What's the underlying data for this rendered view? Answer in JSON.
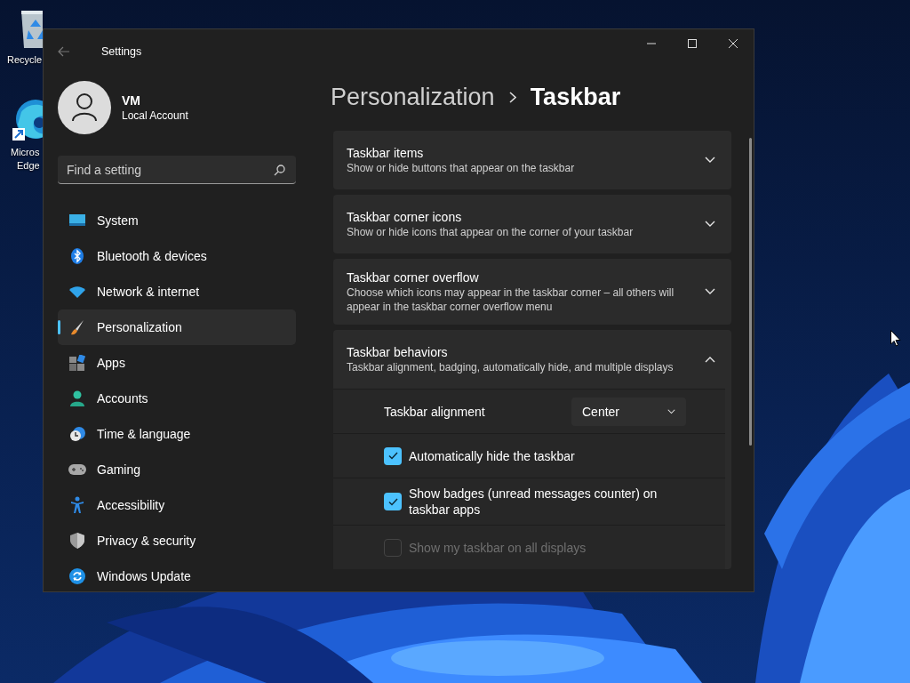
{
  "desktop": {
    "icons": [
      {
        "lines": [
          "Recycle"
        ]
      },
      {
        "lines": [
          "Micros",
          "Edge"
        ]
      }
    ]
  },
  "window": {
    "title": "Settings",
    "user": {
      "name": "VM",
      "account": "Local Account"
    },
    "search": {
      "placeholder": "Find a setting"
    },
    "nav": [
      {
        "label": "System",
        "selected": false
      },
      {
        "label": "Bluetooth & devices",
        "selected": false
      },
      {
        "label": "Network & internet",
        "selected": false
      },
      {
        "label": "Personalization",
        "selected": true
      },
      {
        "label": "Apps",
        "selected": false
      },
      {
        "label": "Accounts",
        "selected": false
      },
      {
        "label": "Time & language",
        "selected": false
      },
      {
        "label": "Gaming",
        "selected": false
      },
      {
        "label": "Accessibility",
        "selected": false
      },
      {
        "label": "Privacy & security",
        "selected": false
      },
      {
        "label": "Windows Update",
        "selected": false
      }
    ],
    "breadcrumb": {
      "parent": "Personalization",
      "current": "Taskbar"
    },
    "sections": [
      {
        "title": "Taskbar items",
        "description": "Show or hide buttons that appear on the taskbar",
        "expanded": false
      },
      {
        "title": "Taskbar corner icons",
        "description": "Show or hide icons that appear on the corner of your taskbar",
        "expanded": false
      },
      {
        "title": "Taskbar corner overflow",
        "description": "Choose which icons may appear in the taskbar corner – all others will appear in the taskbar corner overflow menu",
        "expanded": false
      },
      {
        "title": "Taskbar behaviors",
        "description": "Taskbar alignment, badging, automatically hide, and multiple displays",
        "expanded": true,
        "settings": [
          {
            "kind": "dropdown",
            "label": "Taskbar alignment",
            "value": "Center"
          },
          {
            "kind": "checkbox",
            "label": "Automatically hide the taskbar",
            "checked": true,
            "disabled": false
          },
          {
            "kind": "checkbox",
            "label": "Show badges (unread messages counter) on taskbar apps",
            "checked": true,
            "disabled": false
          },
          {
            "kind": "checkbox",
            "label": "Show my taskbar on all displays",
            "checked": false,
            "disabled": true
          }
        ]
      }
    ]
  }
}
